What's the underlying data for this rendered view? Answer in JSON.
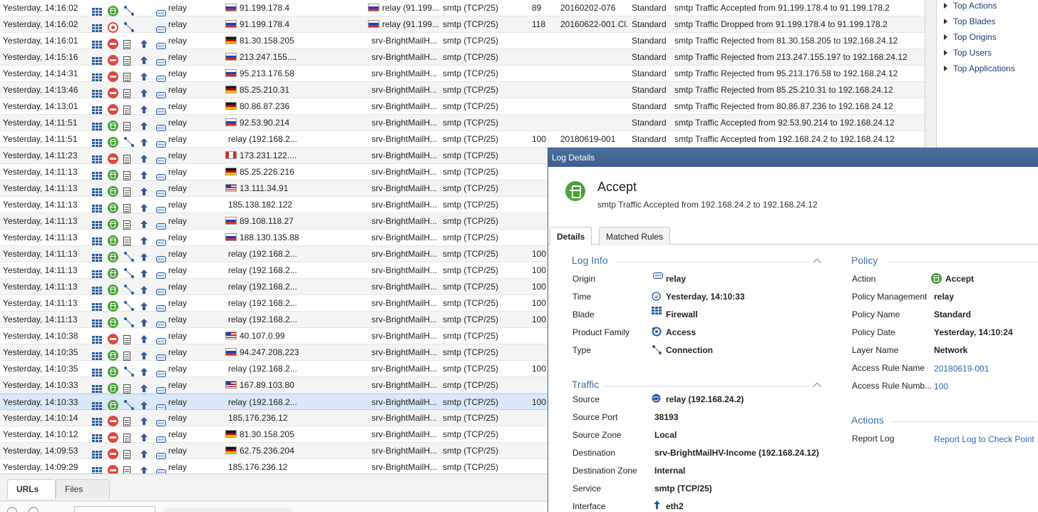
{
  "log_rows": [
    {
      "time": "Yesterday, 14:16:02",
      "action": "accept",
      "type": "connection",
      "has_log": false,
      "origin": "relay",
      "src_flag": "ru",
      "src": "91.199.178.4",
      "dst_flag": "ru",
      "dst": "relay (91.199....",
      "svc": "smtp (TCP/25)",
      "rule_num": "89",
      "rule_name": "20160202-076",
      "policy": "Standard",
      "desc": "smtp Traffic Accepted from 91.199.178.4 to 91.199.178.2"
    },
    {
      "time": "Yesterday, 14:16:02",
      "action": "drop",
      "type": "connection",
      "has_log": false,
      "origin": "relay",
      "src_flag": "ru",
      "src": "91.199.178.4",
      "dst_flag": "ru",
      "dst": "relay (91.199....",
      "svc": "smtp (TCP/25)",
      "rule_num": "118",
      "rule_name": "20160622-001 Cl...",
      "policy": "Standard",
      "desc": "smtp Traffic Dropped from 91.199.178.4 to 91.199.178.2"
    },
    {
      "time": "Yesterday, 14:16:01",
      "action": "reject",
      "type": "log",
      "has_log": true,
      "origin": "relay",
      "src_flag": "de",
      "src": "81.30.158.205",
      "dst_flag": "",
      "dst": "srv-BrightMailH...",
      "svc": "smtp (TCP/25)",
      "rule_num": "",
      "rule_name": "",
      "policy": "Standard",
      "desc": "smtp Traffic Rejected from 81.30.158.205 to 192.168.24.12"
    },
    {
      "time": "Yesterday, 14:15:16",
      "action": "reject",
      "type": "log",
      "has_log": true,
      "origin": "relay",
      "src_flag": "ru",
      "src": "213.247.155....",
      "dst_flag": "",
      "dst": "srv-BrightMailH...",
      "svc": "smtp (TCP/25)",
      "rule_num": "",
      "rule_name": "",
      "policy": "Standard",
      "desc": "smtp Traffic Rejected from 213.247.155.197 to 192.168.24.12"
    },
    {
      "time": "Yesterday, 14:14:31",
      "action": "reject",
      "type": "log",
      "has_log": true,
      "origin": "relay",
      "src_flag": "ru",
      "src": "95.213.176.58",
      "dst_flag": "",
      "dst": "srv-BrightMailH...",
      "svc": "smtp (TCP/25)",
      "rule_num": "",
      "rule_name": "",
      "policy": "Standard",
      "desc": "smtp Traffic Rejected from 95.213.176.58 to 192.168.24.12"
    },
    {
      "time": "Yesterday, 14:13:46",
      "action": "reject",
      "type": "log",
      "has_log": true,
      "origin": "relay",
      "src_flag": "de",
      "src": "85.25.210.31",
      "dst_flag": "",
      "dst": "srv-BrightMailH...",
      "svc": "smtp (TCP/25)",
      "rule_num": "",
      "rule_name": "",
      "policy": "Standard",
      "desc": "smtp Traffic Rejected from 85.25.210.31 to 192.168.24.12"
    },
    {
      "time": "Yesterday, 14:13:01",
      "action": "reject",
      "type": "log",
      "has_log": true,
      "origin": "relay",
      "src_flag": "de",
      "src": "80.86.87.236",
      "dst_flag": "",
      "dst": "srv-BrightMailH...",
      "svc": "smtp (TCP/25)",
      "rule_num": "",
      "rule_name": "",
      "policy": "Standard",
      "desc": "smtp Traffic Rejected from 80.86.87.236 to 192.168.24.12"
    },
    {
      "time": "Yesterday, 14:11:51",
      "action": "accept",
      "type": "log",
      "has_log": true,
      "origin": "relay",
      "src_flag": "ru",
      "src": "92.53.90.214",
      "dst_flag": "",
      "dst": "srv-BrightMailH...",
      "svc": "smtp (TCP/25)",
      "rule_num": "",
      "rule_name": "",
      "policy": "Standard",
      "desc": "smtp Traffic Accepted from 92.53.90.214 to 192.168.24.12"
    },
    {
      "time": "Yesterday, 14:11:51",
      "action": "accept",
      "type": "connection",
      "has_log": true,
      "origin": "relay",
      "src_flag": "",
      "src": "relay (192.168.2...",
      "dst_flag": "",
      "dst": "srv-BrightMailH...",
      "svc": "smtp (TCP/25)",
      "rule_num": "100",
      "rule_name": "20180619-001",
      "policy": "Standard",
      "desc": "smtp Traffic Accepted from 192.168.24.2 to 192.168.24.12"
    },
    {
      "time": "Yesterday, 14:11:23",
      "action": "reject",
      "type": "log",
      "has_log": true,
      "origin": "relay",
      "src_flag": "ca",
      "src": "173.231.122....",
      "dst_flag": "",
      "dst": "srv-BrightMailH...",
      "svc": "smtp (TCP/25)",
      "rule_num": "",
      "rule_name": "",
      "policy": "",
      "desc": ""
    },
    {
      "time": "Yesterday, 14:11:13",
      "action": "accept",
      "type": "log",
      "has_log": true,
      "origin": "relay",
      "src_flag": "de",
      "src": "85.25.226.216",
      "dst_flag": "",
      "dst": "srv-BrightMailH...",
      "svc": "smtp (TCP/25)",
      "rule_num": "",
      "rule_name": "",
      "policy": "",
      "desc": ""
    },
    {
      "time": "Yesterday, 14:11:13",
      "action": "accept",
      "type": "log",
      "has_log": true,
      "origin": "relay",
      "src_flag": "us",
      "src": "13.111.34.91",
      "dst_flag": "",
      "dst": "srv-BrightMailH...",
      "svc": "smtp (TCP/25)",
      "rule_num": "",
      "rule_name": "",
      "policy": "",
      "desc": ""
    },
    {
      "time": "Yesterday, 14:11:13",
      "action": "accept",
      "type": "log",
      "has_log": true,
      "origin": "relay",
      "src_flag": "",
      "src": "185.138.182.122",
      "dst_flag": "",
      "dst": "srv-BrightMailH...",
      "svc": "smtp (TCP/25)",
      "rule_num": "",
      "rule_name": "",
      "policy": "",
      "desc": ""
    },
    {
      "time": "Yesterday, 14:11:13",
      "action": "accept",
      "type": "log",
      "has_log": true,
      "origin": "relay",
      "src_flag": "ru",
      "src": "89.108.118.27",
      "dst_flag": "",
      "dst": "srv-BrightMailH...",
      "svc": "smtp (TCP/25)",
      "rule_num": "",
      "rule_name": "",
      "policy": "",
      "desc": ""
    },
    {
      "time": "Yesterday, 14:11:13",
      "action": "accept",
      "type": "log",
      "has_log": true,
      "origin": "relay",
      "src_flag": "ru",
      "src": "188.130.135.88",
      "dst_flag": "",
      "dst": "srv-BrightMailH...",
      "svc": "smtp (TCP/25)",
      "rule_num": "",
      "rule_name": "",
      "policy": "",
      "desc": ""
    },
    {
      "time": "Yesterday, 14:11:13",
      "action": "accept",
      "type": "connection",
      "has_log": true,
      "origin": "relay",
      "src_flag": "",
      "src": "relay (192.168.2...",
      "dst_flag": "",
      "dst": "srv-BrightMailH...",
      "svc": "smtp (TCP/25)",
      "rule_num": "100",
      "rule_name": "",
      "policy": "",
      "desc": ""
    },
    {
      "time": "Yesterday, 14:11:13",
      "action": "accept",
      "type": "connection",
      "has_log": true,
      "origin": "relay",
      "src_flag": "",
      "src": "relay (192.168.2...",
      "dst_flag": "",
      "dst": "srv-BrightMailH...",
      "svc": "smtp (TCP/25)",
      "rule_num": "100",
      "rule_name": "",
      "policy": "",
      "desc": ""
    },
    {
      "time": "Yesterday, 14:11:13",
      "action": "accept",
      "type": "connection",
      "has_log": true,
      "origin": "relay",
      "src_flag": "",
      "src": "relay (192.168.2...",
      "dst_flag": "",
      "dst": "srv-BrightMailH...",
      "svc": "smtp (TCP/25)",
      "rule_num": "100",
      "rule_name": "",
      "policy": "",
      "desc": ""
    },
    {
      "time": "Yesterday, 14:11:13",
      "action": "accept",
      "type": "connection",
      "has_log": true,
      "origin": "relay",
      "src_flag": "",
      "src": "relay (192.168.2...",
      "dst_flag": "",
      "dst": "srv-BrightMailH...",
      "svc": "smtp (TCP/25)",
      "rule_num": "100",
      "rule_name": "",
      "policy": "",
      "desc": ""
    },
    {
      "time": "Yesterday, 14:11:13",
      "action": "accept",
      "type": "connection",
      "has_log": true,
      "origin": "relay",
      "src_flag": "",
      "src": "relay (192.168.2...",
      "dst_flag": "",
      "dst": "srv-BrightMailH...",
      "svc": "smtp (TCP/25)",
      "rule_num": "100",
      "rule_name": "",
      "policy": "",
      "desc": ""
    },
    {
      "time": "Yesterday, 14:10:38",
      "action": "reject",
      "type": "log",
      "has_log": true,
      "origin": "relay",
      "src_flag": "us",
      "src": "40.107.0.99",
      "dst_flag": "",
      "dst": "srv-BrightMailH...",
      "svc": "smtp (TCP/25)",
      "rule_num": "",
      "rule_name": "",
      "policy": "",
      "desc": ""
    },
    {
      "time": "Yesterday, 14:10:35",
      "action": "accept",
      "type": "log",
      "has_log": true,
      "origin": "relay",
      "src_flag": "ru",
      "src": "94.247.208.223",
      "dst_flag": "",
      "dst": "srv-BrightMailH...",
      "svc": "smtp (TCP/25)",
      "rule_num": "",
      "rule_name": "",
      "policy": "",
      "desc": ""
    },
    {
      "time": "Yesterday, 14:10:35",
      "action": "accept",
      "type": "connection",
      "has_log": true,
      "origin": "relay",
      "src_flag": "",
      "src": "relay (192.168.2...",
      "dst_flag": "",
      "dst": "srv-BrightMailH...",
      "svc": "smtp (TCP/25)",
      "rule_num": "100",
      "rule_name": "",
      "policy": "",
      "desc": ""
    },
    {
      "time": "Yesterday, 14:10:33",
      "action": "accept",
      "type": "log",
      "has_log": true,
      "origin": "relay",
      "src_flag": "us",
      "src": "167.89.103.80",
      "dst_flag": "",
      "dst": "srv-BrightMailH...",
      "svc": "smtp (TCP/25)",
      "rule_num": "",
      "rule_name": "",
      "policy": "",
      "desc": ""
    },
    {
      "time": "Yesterday, 14:10:33",
      "action": "accept",
      "type": "connection",
      "has_log": true,
      "origin": "relay",
      "src_flag": "",
      "src": "relay (192.168.2...",
      "dst_flag": "",
      "dst": "srv-BrightMailH...",
      "svc": "smtp (TCP/25)",
      "rule_num": "100",
      "rule_name": "",
      "policy": "",
      "desc": "",
      "selected": true
    },
    {
      "time": "Yesterday, 14:10:14",
      "action": "reject",
      "type": "log",
      "has_log": true,
      "origin": "relay",
      "src_flag": "",
      "src": "185.176.236.12",
      "dst_flag": "",
      "dst": "srv-BrightMailH...",
      "svc": "smtp (TCP/25)",
      "rule_num": "",
      "rule_name": "",
      "policy": "",
      "desc": ""
    },
    {
      "time": "Yesterday, 14:10:12",
      "action": "reject",
      "type": "log",
      "has_log": true,
      "origin": "relay",
      "src_flag": "de",
      "src": "81.30.158.205",
      "dst_flag": "",
      "dst": "srv-BrightMailH...",
      "svc": "smtp (TCP/25)",
      "rule_num": "",
      "rule_name": "",
      "policy": "",
      "desc": ""
    },
    {
      "time": "Yesterday, 14:09:53",
      "action": "reject",
      "type": "log",
      "has_log": true,
      "origin": "relay",
      "src_flag": "de",
      "src": "62.75.236.204",
      "dst_flag": "",
      "dst": "srv-BrightMailH...",
      "svc": "smtp (TCP/25)",
      "rule_num": "",
      "rule_name": "",
      "policy": "",
      "desc": ""
    },
    {
      "time": "Yesterday, 14:09:29",
      "action": "reject",
      "type": "log",
      "has_log": true,
      "origin": "relay",
      "src_flag": "",
      "src": "185.176.236.12",
      "dst_flag": "",
      "dst": "srv-BrightMailH...",
      "svc": "smtp (TCP/25)",
      "rule_num": "",
      "rule_name": "",
      "policy": "",
      "desc": ""
    }
  ],
  "right_panel": {
    "items": [
      "Top Actions",
      "Top Blades",
      "Top Origins",
      "Top Users",
      "Top Applications"
    ]
  },
  "bottom_tabs": {
    "urls": "URLs",
    "files": "Files"
  },
  "log_details": {
    "window_title": "Log Details",
    "action_title": "Accept",
    "subtitle": "smtp Traffic Accepted from 192.168.24.2 to 192.168.24.12",
    "tabs": {
      "details": "Details",
      "matched_rules": "Matched Rules"
    },
    "log_info": {
      "title": "Log Info",
      "origin_label": "Origin",
      "origin": "relay",
      "time_label": "Time",
      "time": "Yesterday, 14:10:33",
      "blade_label": "Blade",
      "blade": "Firewall",
      "product_family_label": "Product Family",
      "product_family": "Access",
      "type_label": "Type",
      "type": "Connection"
    },
    "traffic": {
      "title": "Traffic",
      "source_label": "Source",
      "source": "relay (192.168.24.2)",
      "source_port_label": "Source Port",
      "source_port": "38193",
      "source_zone_label": "Source Zone",
      "source_zone": "Local",
      "destination_label": "Destination",
      "destination": "srv-BrightMailHV-Income (192.168.24.12)",
      "destination_zone_label": "Destination Zone",
      "destination_zone": "Internal",
      "service_label": "Service",
      "service": "smtp (TCP/25)",
      "interface_label": "Interface",
      "interface": "eth2"
    },
    "policy": {
      "title": "Policy",
      "action_label": "Action",
      "action": "Accept",
      "policy_management_label": "Policy Management",
      "policy_management": "relay",
      "policy_name_label": "Policy Name",
      "policy_name": "Standard",
      "policy_date_label": "Policy Date",
      "policy_date": "Yesterday, 14:10:24",
      "layer_name_label": "Layer Name",
      "layer_name": "Network",
      "access_rule_name_label": "Access Rule Name",
      "access_rule_name": "20180619-001",
      "access_rule_number_label": "Access Rule Numb...",
      "access_rule_number": "100"
    },
    "actions": {
      "title": "Actions",
      "report_log_label": "Report Log",
      "report_log_link": "Report Log to Check Point"
    }
  },
  "colors": {
    "accept": "#4aa33a",
    "reject": "#e2453c",
    "link": "#2e68b5",
    "section_title": "#3f6ea6",
    "titlebar": "#3c5f8d"
  }
}
